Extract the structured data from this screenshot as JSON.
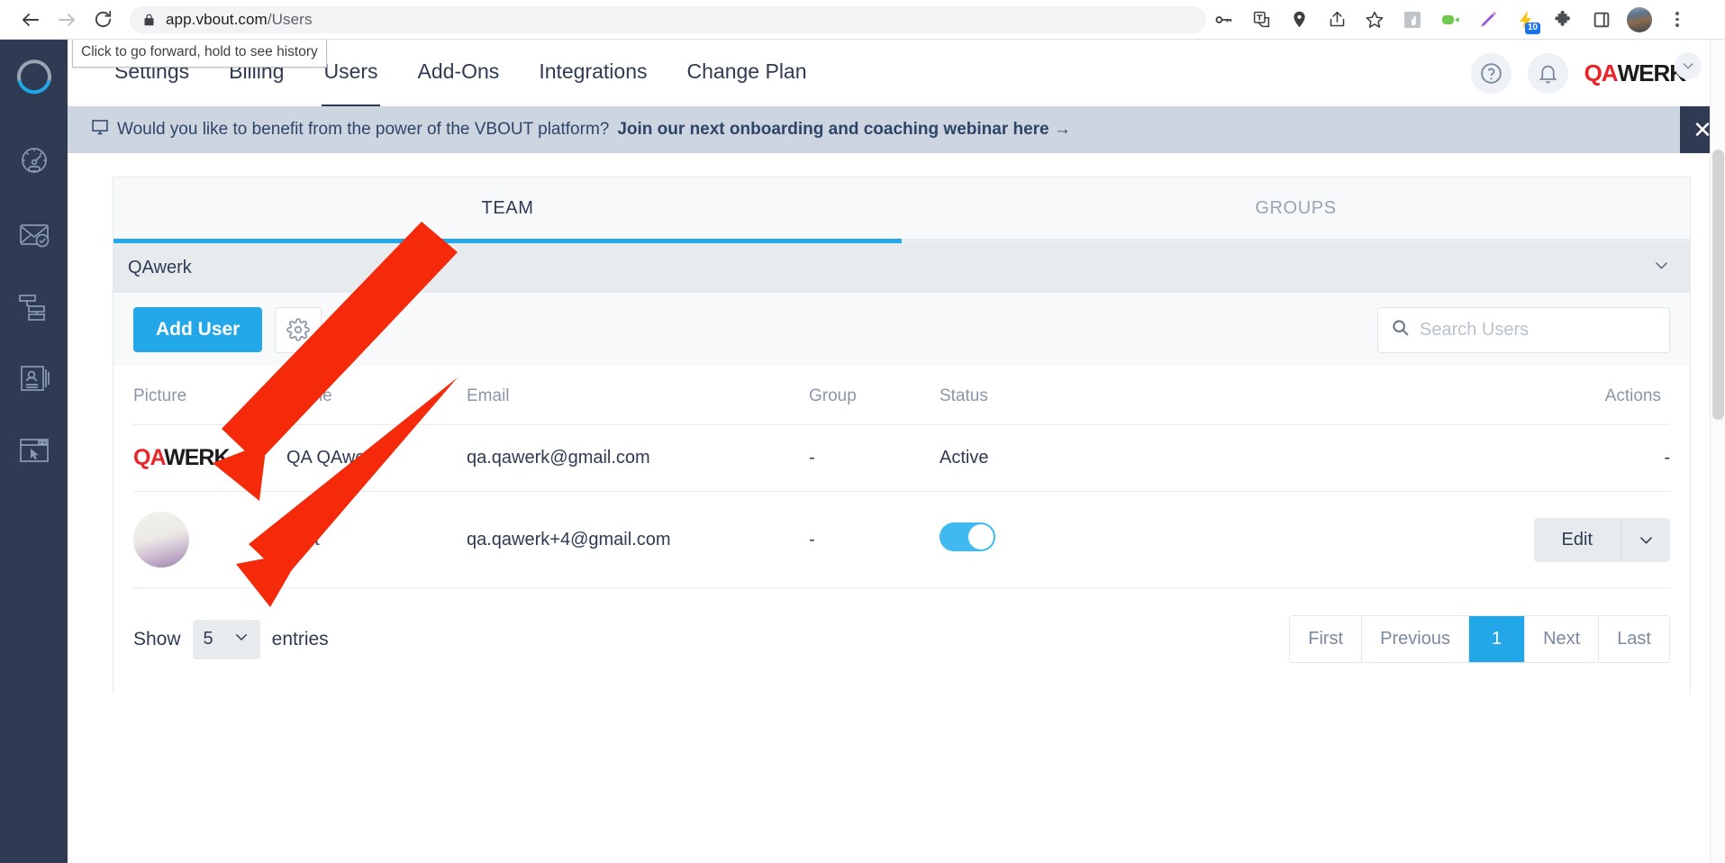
{
  "browser": {
    "back_icon": "back-arrow-icon",
    "forward_icon": "forward-arrow-icon",
    "reload_icon": "reload-icon",
    "lock_icon": "lock-icon",
    "url_host": "app.vbout.com",
    "url_path": "/Users",
    "tooltip": "Click to go forward, hold to see history",
    "toolbar_icons": [
      "password-key-icon",
      "translate-icon",
      "location-pin-icon",
      "share-icon",
      "bookmark-star-icon",
      "extension-hand-icon",
      "video-record-icon",
      "highlighter-pen-icon",
      "lightning-extension-icon",
      "puzzle-extensions-icon",
      "side-panel-icon",
      "profile-avatar",
      "chrome-menu-icon"
    ],
    "extension_badge_count": "10"
  },
  "sidebar": {
    "logo_name": "vbout-logo",
    "items": [
      {
        "name": "dashboard-icon"
      },
      {
        "name": "email-marketing-icon"
      },
      {
        "name": "automation-workflow-icon"
      },
      {
        "name": "contact-card-icon"
      },
      {
        "name": "landing-page-icon"
      }
    ]
  },
  "header": {
    "nav": [
      {
        "label": "Settings",
        "active": false
      },
      {
        "label": "Billing",
        "active": false
      },
      {
        "label": "Users",
        "active": true
      },
      {
        "label": "Add-Ons",
        "active": false
      },
      {
        "label": "Integrations",
        "active": false
      },
      {
        "label": "Change Plan",
        "active": false
      }
    ],
    "help_icon": "help-question-icon",
    "notification_icon": "bell-icon",
    "account_logo_primary": "QA",
    "account_logo_secondary": "WERK",
    "account_chevron": "chevron-down-icon"
  },
  "banner": {
    "monitor_icon": "monitor-icon",
    "text": "Would you like to benefit from the power of the VBOUT platform?",
    "link": "Join our next onboarding and coaching webinar here →",
    "close_label": "✕"
  },
  "tabs": [
    {
      "label": "TEAM",
      "active": true
    },
    {
      "label": "GROUPS",
      "active": false
    }
  ],
  "account_select": {
    "value": "QAwerk",
    "chevron_icon": "chevron-down-icon"
  },
  "toolbar": {
    "add_user_label": "Add User",
    "settings_icon": "gear-icon"
  },
  "search": {
    "icon": "search-icon",
    "value": "",
    "placeholder": "Search Users"
  },
  "table": {
    "columns": [
      "Picture",
      "Name",
      "Email",
      "Group",
      "Status",
      "Actions"
    ],
    "rows": [
      {
        "picture_type": "qawerk-logo",
        "logo_primary": "QA",
        "logo_secondary": "WERK",
        "name": "QA QAwerk",
        "email": "qa.qawerk@gmail.com",
        "group": "-",
        "status_type": "text",
        "status": "Active",
        "actions_type": "text",
        "actions": "-"
      },
      {
        "picture_type": "photo-avatar",
        "logo_primary": "",
        "logo_secondary": "",
        "name": "Test",
        "email": "qa.qawerk+4@gmail.com",
        "group": "-",
        "status_type": "toggle",
        "status": "on",
        "actions_type": "button",
        "edit_label": "Edit",
        "caret_icon": "chevron-down-icon"
      }
    ]
  },
  "footer": {
    "show_label": "Show",
    "entries_value": "5",
    "entries_label": "entries",
    "entries_chevron": "chevron-down-icon",
    "pagination": [
      {
        "label": "First",
        "active": false
      },
      {
        "label": "Previous",
        "active": false
      },
      {
        "label": "1",
        "active": true
      },
      {
        "label": "Next",
        "active": false
      },
      {
        "label": "Last",
        "active": false
      }
    ]
  },
  "colors": {
    "accent_blue": "#22a7e8",
    "sidebar_navy": "#2e3b53",
    "banner_bg": "#cdd6e0",
    "annotation_red": "#f42a0a"
  }
}
